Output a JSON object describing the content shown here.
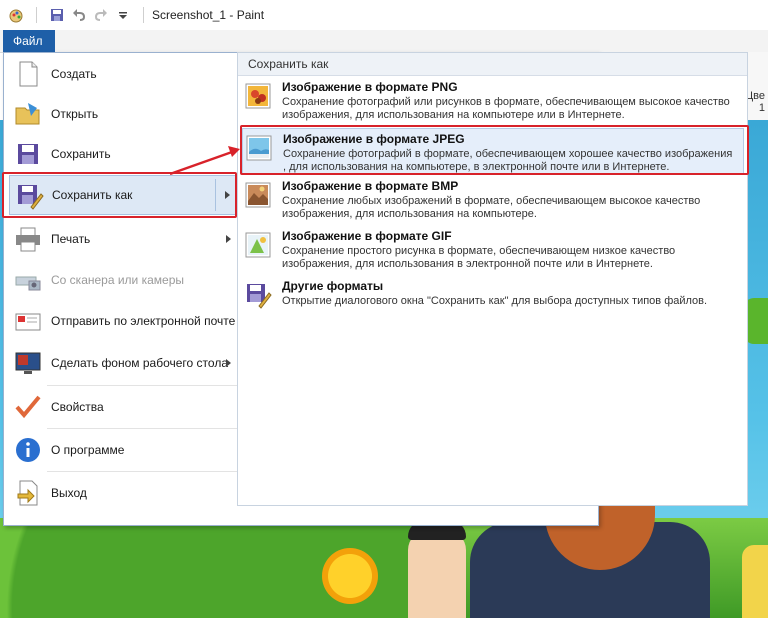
{
  "app": {
    "title": "Screenshot_1 - Paint",
    "file_tab": "Файл",
    "ribbon_right_label_1": "Цве",
    "ribbon_right_label_2": "1"
  },
  "quick_access": {
    "icons": [
      "paint-app-icon",
      "save-icon",
      "undo-icon",
      "redo-icon",
      "customize-dropdown-icon"
    ]
  },
  "file_menu": {
    "items": [
      {
        "label": "Создать",
        "icon": "new-file-icon",
        "enabled": true,
        "submenu": false
      },
      {
        "label": "Открыть",
        "icon": "open-folder-icon",
        "enabled": true,
        "submenu": false
      },
      {
        "label": "Сохранить",
        "icon": "save-floppy-icon",
        "enabled": true,
        "submenu": false
      },
      {
        "label": "Сохранить как",
        "icon": "save-as-icon",
        "enabled": true,
        "submenu": true,
        "active": true
      },
      {
        "label": "Печать",
        "icon": "printer-icon",
        "enabled": true,
        "submenu": true
      },
      {
        "label": "Со сканера или камеры",
        "icon": "scanner-icon",
        "enabled": false,
        "submenu": false
      },
      {
        "label": "Отправить по электронной почте",
        "icon": "email-icon",
        "enabled": true,
        "submenu": false
      },
      {
        "label": "Сделать фоном рабочего стола",
        "icon": "desktop-background-icon",
        "enabled": true,
        "submenu": true
      },
      {
        "label": "Свойства",
        "icon": "checkmark-icon",
        "enabled": true,
        "submenu": false
      },
      {
        "label": "О программе",
        "icon": "info-icon",
        "enabled": true,
        "submenu": false
      },
      {
        "label": "Выход",
        "icon": "exit-icon",
        "enabled": true,
        "submenu": false
      }
    ]
  },
  "save_as_panel": {
    "header": "Сохранить как",
    "options": [
      {
        "title": "Изображение в формате PNG",
        "description": "Сохранение фотографий или рисунков в формате, обеспечивающем высокое качество изображения, для использования на компьютере или в Интернете.",
        "icon": "png-format-icon"
      },
      {
        "title": "Изображение в формате JPEG",
        "description": "Сохранение фотографий в формате, обеспечивающем хорошее качество изображения , для использования на компьютере, в электронной почте или в Интернете.",
        "icon": "jpeg-format-icon",
        "highlighted": true
      },
      {
        "title": "Изображение в формате BMP",
        "description": "Сохранение любых изображений в формате, обеспечивающем высокое качество изображения, для использования на компьютере.",
        "icon": "bmp-format-icon"
      },
      {
        "title": "Изображение в формате GIF",
        "description": "Сохранение простого рисунка в формате, обеспечивающем низкое качество изображения, для использования в электронной почте или в Интернете.",
        "icon": "gif-format-icon"
      },
      {
        "title": "Другие форматы",
        "description": "Открытие диалогового окна \"Сохранить как\" для выбора доступных типов файлов.",
        "icon": "other-formats-icon"
      }
    ]
  },
  "colors": {
    "file_tab": "#1e5fa8",
    "highlight": "#e5eefa",
    "annotation_red": "#d8222a"
  }
}
